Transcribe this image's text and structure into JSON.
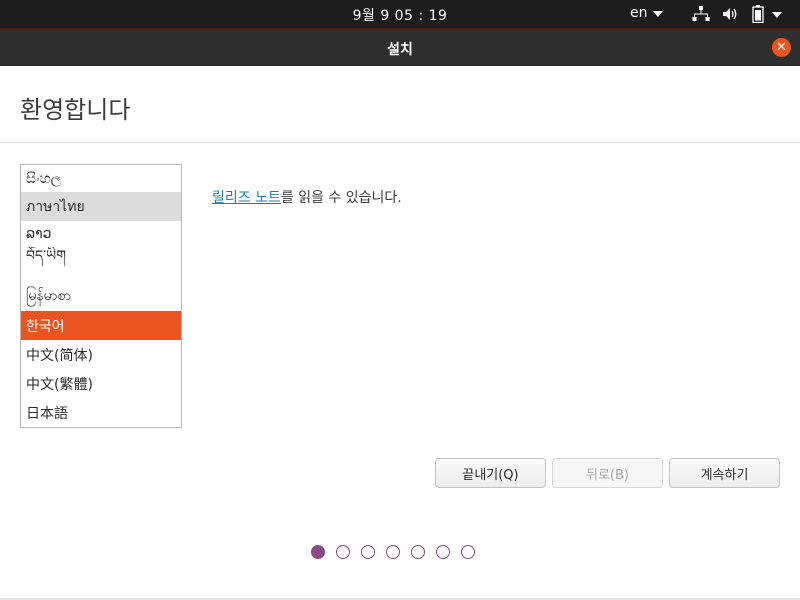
{
  "topbar": {
    "clock": "9월 9  05 : 19",
    "language": "en",
    "icons": [
      "network-icon",
      "volume-icon",
      "battery-icon",
      "chevron-down-icon"
    ]
  },
  "window": {
    "title": "설치",
    "close_icon": "close-icon"
  },
  "page": {
    "title": "환영합니다"
  },
  "languages": {
    "items": [
      {
        "label": "සිංහල",
        "state": "normal"
      },
      {
        "label": "ภาษาไทย",
        "state": "hover"
      },
      {
        "label": "ລາວ",
        "state": "normal"
      },
      {
        "label": "བོད་ཡིག",
        "state": "normal"
      },
      {
        "label": "မြန်မာစာ",
        "state": "normal"
      },
      {
        "label": "한국어",
        "state": "selected"
      },
      {
        "label": "中文(简体)",
        "state": "normal"
      },
      {
        "label": "中文(繁體)",
        "state": "normal"
      },
      {
        "label": "日本語",
        "state": "normal"
      }
    ]
  },
  "release_notes": {
    "link_text": "릴리즈 노트",
    "rest_text": "를 읽을 수 있습니다."
  },
  "buttons": {
    "quit": "끝내기(Q)",
    "back": "뒤로(B)",
    "continue": "계속하기"
  },
  "progress": {
    "current_step": 1,
    "total_steps": 7
  },
  "colors": {
    "accent": "#e95420",
    "dot": "#8a4a87",
    "link": "#1a7fb5"
  }
}
